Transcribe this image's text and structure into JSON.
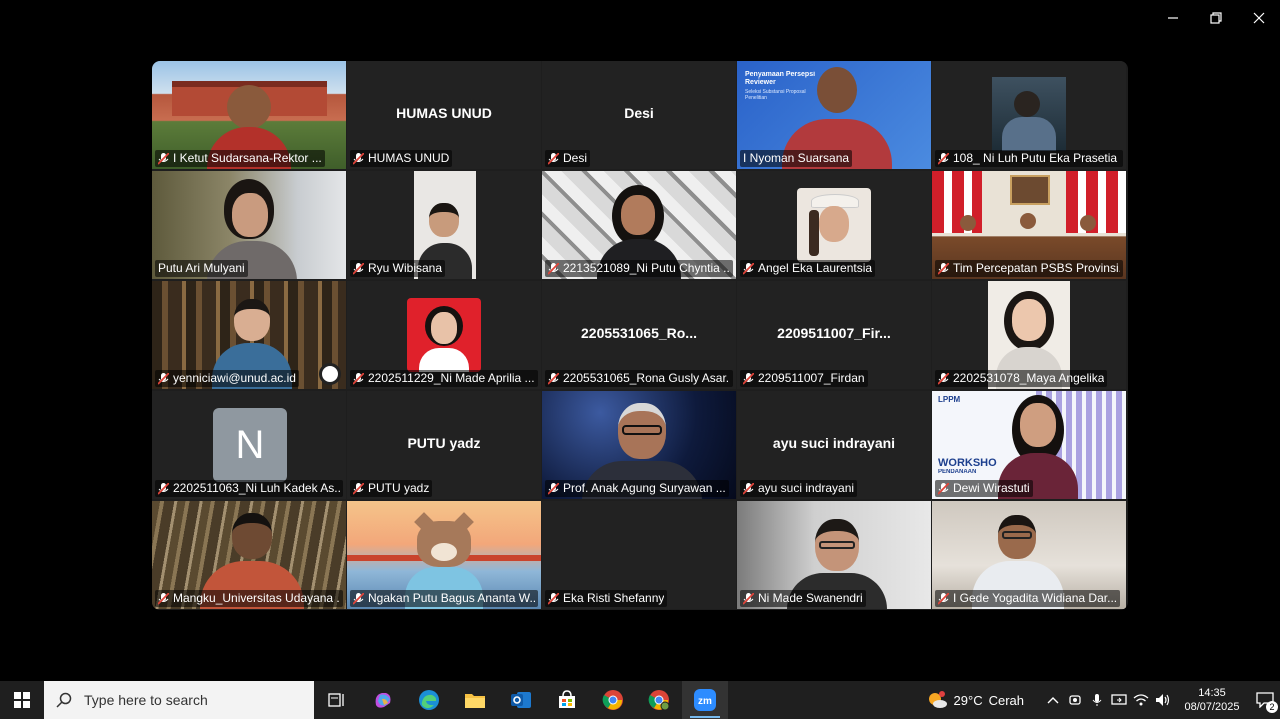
{
  "meeting": {
    "tiles": [
      {
        "label": "I Ketut Sudarsana-Rektor ..."
      },
      {
        "label": "HUMAS UNUD",
        "center": "HUMAS UNUD"
      },
      {
        "label": "Desi",
        "center": "Desi"
      },
      {
        "label": "I Nyoman Suarsana",
        "slide_title": "Penyamaan Persepsi Reviewer",
        "slide_sub": "Seleksi Substansi Proposal Penelitian"
      },
      {
        "label": "108_ Ni Luh Putu Eka Prasetia ..."
      },
      {
        "label": "Putu Ari Mulyani",
        "active": true
      },
      {
        "label": "Ryu Wibisana"
      },
      {
        "label": "2213521089_Ni Putu Chyntia ..."
      },
      {
        "label": "Angel Eka Laurentsia"
      },
      {
        "label": "Tim Percepatan PSBS Provinsi..."
      },
      {
        "label": "yenniciawi@unud.ac.id"
      },
      {
        "label": "2202511229_Ni Made Aprilia ..."
      },
      {
        "label": "2205531065_Rona Gusly Asar...",
        "center": "2205531065_Ro..."
      },
      {
        "label": "2209511007_Firdan",
        "center": "2209511007_Fir..."
      },
      {
        "label": "2202531078_Maya Angelika"
      },
      {
        "label": "2202511063_Ni Luh Kadek As...",
        "avatar": "N"
      },
      {
        "label": "PUTU yadz",
        "center": "PUTU yadz"
      },
      {
        "label": "Prof. Anak Agung Suryawan ..."
      },
      {
        "label": "ayu suci indrayani",
        "center": "ayu suci indrayani"
      },
      {
        "label": "Dewi Wirastuti",
        "slide_logo": "LPPM",
        "slide_title": "WORKSHO",
        "slide_sub": "PENDANAAN"
      },
      {
        "label": "Mangku_Universitas Udayana ..."
      },
      {
        "label": "Ngakan Putu Bagus Ananta W..."
      },
      {
        "label": "Eka Risti Shefanny"
      },
      {
        "label": "Ni Made Swanendri"
      },
      {
        "label": "I Gede Yogadita Widiana Dar..."
      }
    ]
  },
  "taskbar": {
    "search_placeholder": "Type here to search",
    "weather_temp": "29°C",
    "weather_desc": "Cerah",
    "time": "14:35",
    "date": "08/07/2025",
    "notification_count": "2",
    "zoom_label": "zm"
  },
  "colors": {
    "active_speaker": "#2fd36b",
    "mic_muted": "#e0443a",
    "taskbar": "#1f1f1f"
  }
}
